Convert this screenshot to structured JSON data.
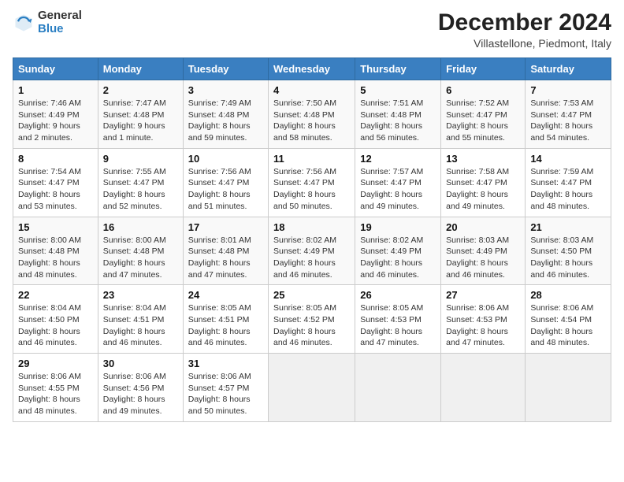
{
  "logo": {
    "general": "General",
    "blue": "Blue"
  },
  "title": "December 2024",
  "subtitle": "Villastellone, Piedmont, Italy",
  "weekdays": [
    "Sunday",
    "Monday",
    "Tuesday",
    "Wednesday",
    "Thursday",
    "Friday",
    "Saturday"
  ],
  "weeks": [
    [
      {
        "day": "1",
        "sunrise": "Sunrise: 7:46 AM",
        "sunset": "Sunset: 4:49 PM",
        "daylight": "Daylight: 9 hours and 2 minutes."
      },
      {
        "day": "2",
        "sunrise": "Sunrise: 7:47 AM",
        "sunset": "Sunset: 4:48 PM",
        "daylight": "Daylight: 9 hours and 1 minute."
      },
      {
        "day": "3",
        "sunrise": "Sunrise: 7:49 AM",
        "sunset": "Sunset: 4:48 PM",
        "daylight": "Daylight: 8 hours and 59 minutes."
      },
      {
        "day": "4",
        "sunrise": "Sunrise: 7:50 AM",
        "sunset": "Sunset: 4:48 PM",
        "daylight": "Daylight: 8 hours and 58 minutes."
      },
      {
        "day": "5",
        "sunrise": "Sunrise: 7:51 AM",
        "sunset": "Sunset: 4:48 PM",
        "daylight": "Daylight: 8 hours and 56 minutes."
      },
      {
        "day": "6",
        "sunrise": "Sunrise: 7:52 AM",
        "sunset": "Sunset: 4:47 PM",
        "daylight": "Daylight: 8 hours and 55 minutes."
      },
      {
        "day": "7",
        "sunrise": "Sunrise: 7:53 AM",
        "sunset": "Sunset: 4:47 PM",
        "daylight": "Daylight: 8 hours and 54 minutes."
      }
    ],
    [
      {
        "day": "8",
        "sunrise": "Sunrise: 7:54 AM",
        "sunset": "Sunset: 4:47 PM",
        "daylight": "Daylight: 8 hours and 53 minutes."
      },
      {
        "day": "9",
        "sunrise": "Sunrise: 7:55 AM",
        "sunset": "Sunset: 4:47 PM",
        "daylight": "Daylight: 8 hours and 52 minutes."
      },
      {
        "day": "10",
        "sunrise": "Sunrise: 7:56 AM",
        "sunset": "Sunset: 4:47 PM",
        "daylight": "Daylight: 8 hours and 51 minutes."
      },
      {
        "day": "11",
        "sunrise": "Sunrise: 7:56 AM",
        "sunset": "Sunset: 4:47 PM",
        "daylight": "Daylight: 8 hours and 50 minutes."
      },
      {
        "day": "12",
        "sunrise": "Sunrise: 7:57 AM",
        "sunset": "Sunset: 4:47 PM",
        "daylight": "Daylight: 8 hours and 49 minutes."
      },
      {
        "day": "13",
        "sunrise": "Sunrise: 7:58 AM",
        "sunset": "Sunset: 4:47 PM",
        "daylight": "Daylight: 8 hours and 49 minutes."
      },
      {
        "day": "14",
        "sunrise": "Sunrise: 7:59 AM",
        "sunset": "Sunset: 4:47 PM",
        "daylight": "Daylight: 8 hours and 48 minutes."
      }
    ],
    [
      {
        "day": "15",
        "sunrise": "Sunrise: 8:00 AM",
        "sunset": "Sunset: 4:48 PM",
        "daylight": "Daylight: 8 hours and 48 minutes."
      },
      {
        "day": "16",
        "sunrise": "Sunrise: 8:00 AM",
        "sunset": "Sunset: 4:48 PM",
        "daylight": "Daylight: 8 hours and 47 minutes."
      },
      {
        "day": "17",
        "sunrise": "Sunrise: 8:01 AM",
        "sunset": "Sunset: 4:48 PM",
        "daylight": "Daylight: 8 hours and 47 minutes."
      },
      {
        "day": "18",
        "sunrise": "Sunrise: 8:02 AM",
        "sunset": "Sunset: 4:49 PM",
        "daylight": "Daylight: 8 hours and 46 minutes."
      },
      {
        "day": "19",
        "sunrise": "Sunrise: 8:02 AM",
        "sunset": "Sunset: 4:49 PM",
        "daylight": "Daylight: 8 hours and 46 minutes."
      },
      {
        "day": "20",
        "sunrise": "Sunrise: 8:03 AM",
        "sunset": "Sunset: 4:49 PM",
        "daylight": "Daylight: 8 hours and 46 minutes."
      },
      {
        "day": "21",
        "sunrise": "Sunrise: 8:03 AM",
        "sunset": "Sunset: 4:50 PM",
        "daylight": "Daylight: 8 hours and 46 minutes."
      }
    ],
    [
      {
        "day": "22",
        "sunrise": "Sunrise: 8:04 AM",
        "sunset": "Sunset: 4:50 PM",
        "daylight": "Daylight: 8 hours and 46 minutes."
      },
      {
        "day": "23",
        "sunrise": "Sunrise: 8:04 AM",
        "sunset": "Sunset: 4:51 PM",
        "daylight": "Daylight: 8 hours and 46 minutes."
      },
      {
        "day": "24",
        "sunrise": "Sunrise: 8:05 AM",
        "sunset": "Sunset: 4:51 PM",
        "daylight": "Daylight: 8 hours and 46 minutes."
      },
      {
        "day": "25",
        "sunrise": "Sunrise: 8:05 AM",
        "sunset": "Sunset: 4:52 PM",
        "daylight": "Daylight: 8 hours and 46 minutes."
      },
      {
        "day": "26",
        "sunrise": "Sunrise: 8:05 AM",
        "sunset": "Sunset: 4:53 PM",
        "daylight": "Daylight: 8 hours and 47 minutes."
      },
      {
        "day": "27",
        "sunrise": "Sunrise: 8:06 AM",
        "sunset": "Sunset: 4:53 PM",
        "daylight": "Daylight: 8 hours and 47 minutes."
      },
      {
        "day": "28",
        "sunrise": "Sunrise: 8:06 AM",
        "sunset": "Sunset: 4:54 PM",
        "daylight": "Daylight: 8 hours and 48 minutes."
      }
    ],
    [
      {
        "day": "29",
        "sunrise": "Sunrise: 8:06 AM",
        "sunset": "Sunset: 4:55 PM",
        "daylight": "Daylight: 8 hours and 48 minutes."
      },
      {
        "day": "30",
        "sunrise": "Sunrise: 8:06 AM",
        "sunset": "Sunset: 4:56 PM",
        "daylight": "Daylight: 8 hours and 49 minutes."
      },
      {
        "day": "31",
        "sunrise": "Sunrise: 8:06 AM",
        "sunset": "Sunset: 4:57 PM",
        "daylight": "Daylight: 8 hours and 50 minutes."
      },
      null,
      null,
      null,
      null
    ]
  ]
}
